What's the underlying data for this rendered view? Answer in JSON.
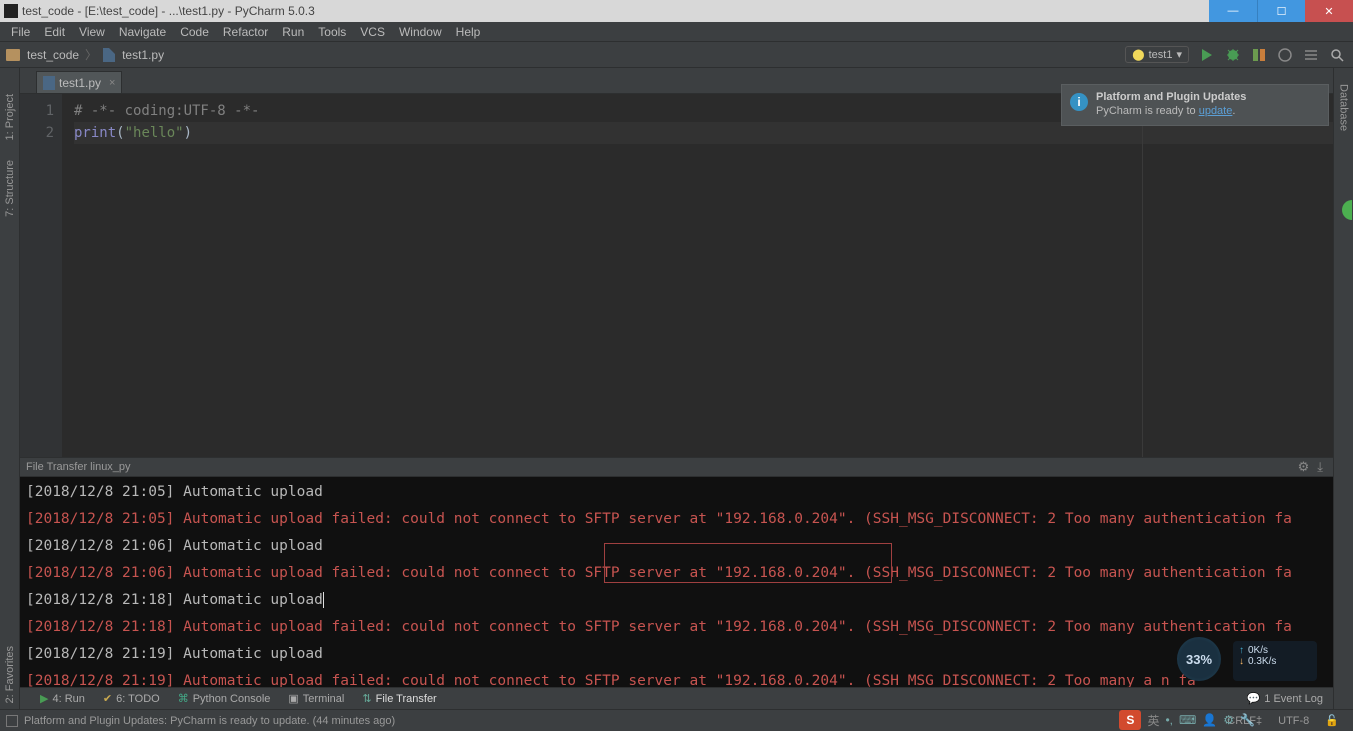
{
  "titlebar": {
    "text": "test_code - [E:\\test_code] - ...\\test1.py - PyCharm 5.0.3"
  },
  "menu": [
    "File",
    "Edit",
    "View",
    "Navigate",
    "Code",
    "Refactor",
    "Run",
    "Tools",
    "VCS",
    "Window",
    "Help"
  ],
  "breadcrumb": {
    "project": "test_code",
    "file": "test1.py"
  },
  "runconfig": {
    "label": "test1"
  },
  "tab": {
    "file": "test1.py"
  },
  "editor": {
    "lines": [
      "1",
      "2"
    ],
    "comment": "# -*- coding:UTF-8 -*-",
    "print_kw": "print",
    "lparen": "(",
    "str": "\"hello\"",
    "rparen": ")"
  },
  "notification": {
    "title": "Platform and Plugin Updates",
    "body_prefix": "PyCharm is ready to ",
    "link": "update",
    "body_suffix": "."
  },
  "side_left": {
    "project": "1: Project",
    "structure": "7: Structure"
  },
  "side_right": {
    "database": "Database"
  },
  "side_bottom_left": {
    "favorites": "2: Favorites"
  },
  "panel": {
    "title": "File Transfer linux_py",
    "logs": [
      {
        "cls": "log-normal",
        "text": "[2018/12/8 21:05] Automatic upload"
      },
      {
        "cls": "log-error",
        "text": "[2018/12/8 21:05] Automatic upload failed: could not connect to SFTP server at \"192.168.0.204\".  (SSH_MSG_DISCONNECT: 2 Too many authentication fa"
      },
      {
        "cls": "log-normal",
        "text": "[2018/12/8 21:06] Automatic upload"
      },
      {
        "cls": "log-error",
        "text": "[2018/12/8 21:06] Automatic upload failed: could not connect to SFTP server at \"192.168.0.204\".  (SSH_MSG_DISCONNECT: 2 Too many authentication fa"
      },
      {
        "cls": "log-normal",
        "text": "[2018/12/8 21:18] Automatic upload"
      },
      {
        "cls": "log-error",
        "text": "[2018/12/8 21:18] Automatic upload failed: could not connect to SFTP server at \"192.168.0.204\".  (SSH_MSG_DISCONNECT: 2 Too many authentication fa"
      },
      {
        "cls": "log-normal",
        "text": "[2018/12/8 21:19] Automatic upload"
      },
      {
        "cls": "log-error",
        "text": "[2018/12/8 21:19] Automatic upload failed: could not connect to SFTP server at \"192.168.0.204\".  (SSH_MSG_DISCONNECT: 2 Too many a                 n fa"
      }
    ]
  },
  "bottomtools": {
    "run": "4: Run",
    "todo": "6: TODO",
    "pyconsole": "Python Console",
    "terminal": "Terminal",
    "filetransfer": "File Transfer",
    "eventlog": "1  Event Log"
  },
  "statusbar": {
    "msg": "Platform and Plugin Updates: PyCharm is ready to update. (44 minutes ago)",
    "crlf": "CRLF‡",
    "enc": "UTF-8",
    "lock": "🔓"
  },
  "perfmon": {
    "value": "33%"
  },
  "netmon": {
    "up": "0K/s",
    "down": "0.3K/s"
  },
  "ime": {
    "lang": "英"
  }
}
